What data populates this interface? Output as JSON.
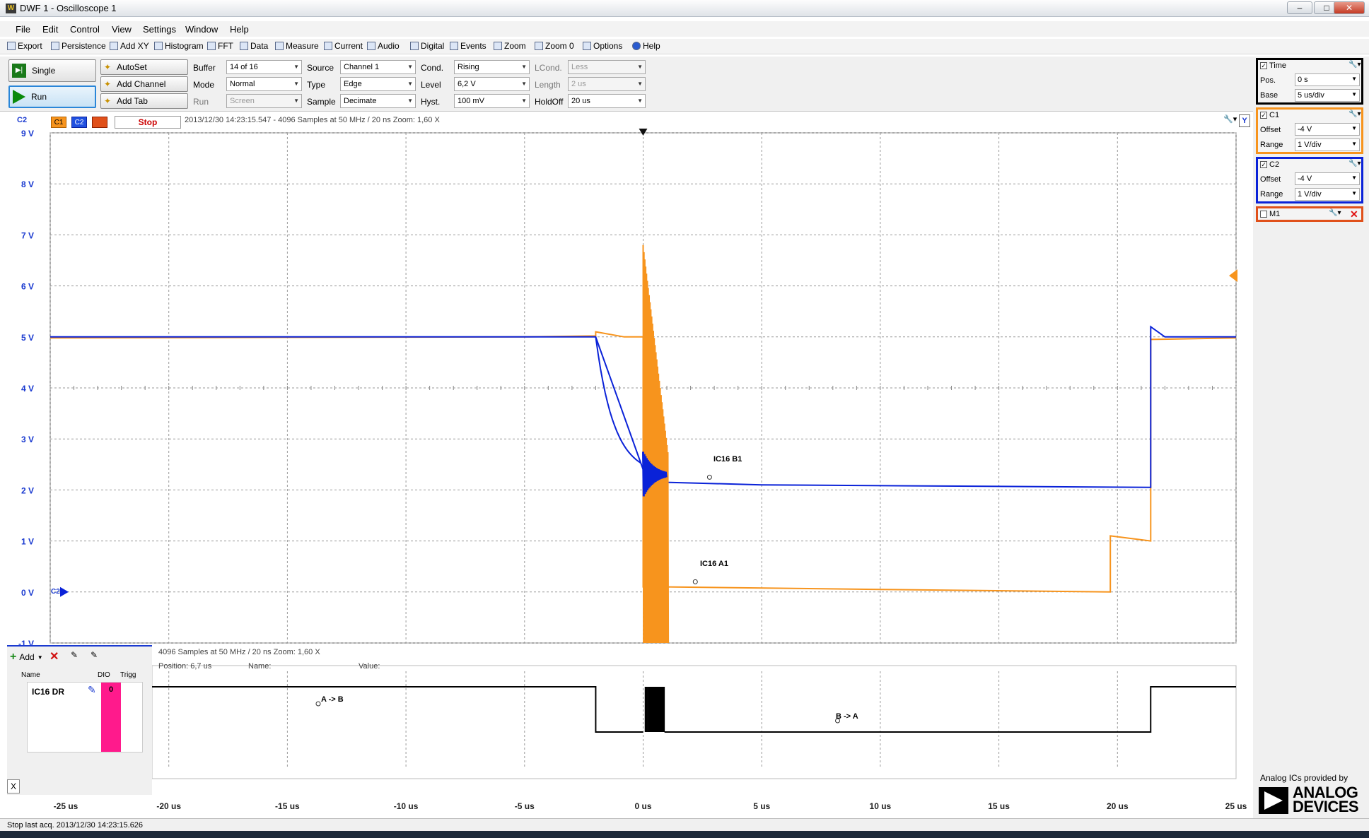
{
  "window": {
    "title": "DWF 1 - Oscilloscope 1",
    "app_icon": "waveforms-icon"
  },
  "menu": [
    "File",
    "Edit",
    "Control",
    "View",
    "Settings",
    "Window",
    "Help"
  ],
  "toolbar": [
    "Export",
    "Persistence",
    "Add XY",
    "Histogram",
    "FFT",
    "Data",
    "Measure",
    "Current",
    "Audio",
    "Digital",
    "Events",
    "Zoom",
    "Zoom 0",
    "Options",
    "Help"
  ],
  "controls": {
    "single": "Single",
    "run": "Run",
    "autoset": "AutoSet",
    "add_channel": "Add Channel",
    "add_tab": "Add Tab",
    "buffer_label": "Buffer",
    "buffer_value": "14 of 16",
    "mode_label": "Mode",
    "mode_value": "Normal",
    "run_label": "Run",
    "run_value": "Screen",
    "source_label": "Source",
    "source_value": "Channel 1",
    "type_label": "Type",
    "type_value": "Edge",
    "sample_label": "Sample",
    "sample_value": "Decimate",
    "cond_label": "Cond.",
    "cond_value": "Rising",
    "level_label": "Level",
    "level_value": "6,2 V",
    "hyst_label": "Hyst.",
    "hyst_value": "100 mV",
    "lcond_label": "LCond.",
    "lcond_value": "Less",
    "length_label": "Length",
    "length_value": "2 us",
    "holdoff_label": "HoldOff",
    "holdoff_value": "20 us"
  },
  "scope": {
    "axis_channel": "C2",
    "chan_tags": [
      "C1",
      "C2",
      "M1"
    ],
    "state": "Stop",
    "info": "2013/12/30  14:23:15.547 - 4096 Samples at 50 MHz / 20 ns Zoom: 1,60 X",
    "y_ticks": [
      "9 V",
      "8 V",
      "7 V",
      "6 V",
      "5 V",
      "4 V",
      "3 V",
      "2 V",
      "1 V",
      "0 V",
      "-1 V"
    ],
    "x_ticks": [
      "-25 us",
      "-20 us",
      "-15 us",
      "-10 us",
      "-5 us",
      "0 us",
      "5 us",
      "10 us",
      "15 us",
      "20 us",
      "25 us"
    ],
    "labels": {
      "b1": "IC16 B1",
      "a1": "IC16 A1",
      "c2_marker": "C2",
      "x_button": "X",
      "y_button": "Y"
    },
    "colors": {
      "c1": "#f7941d",
      "c2": "#0a22d8",
      "m1": "#e0501a",
      "grid": "#9a9a9a"
    }
  },
  "chart_data": [
    {
      "type": "line",
      "series": [
        {
          "name": "C1",
          "points": [
            [
              -25,
              4.98
            ],
            [
              -5,
              5.0
            ],
            [
              -2,
              5.02
            ],
            [
              -2,
              5.1
            ],
            [
              -0.8,
              5.0
            ],
            [
              0,
              5.0
            ],
            [
              0,
              0.1
            ],
            [
              1,
              0.1
            ],
            [
              10,
              0.05
            ],
            [
              19.7,
              0.0
            ],
            [
              19.7,
              1.1
            ],
            [
              21.4,
              1.0
            ],
            [
              21.4,
              4.95
            ],
            [
              25,
              4.98
            ]
          ]
        },
        {
          "name": "C2",
          "points": [
            [
              -25,
              5.0
            ],
            [
              -2,
              5.0
            ],
            [
              -1,
              3.7
            ],
            [
              0,
              2.4
            ],
            [
              1,
              2.15
            ],
            [
              5,
              2.1
            ],
            [
              21.4,
              2.05
            ],
            [
              21.4,
              5.2
            ],
            [
              22,
              5.0
            ],
            [
              25,
              5.0
            ]
          ]
        }
      ],
      "ylim": [
        -1,
        9
      ],
      "xlim": [
        -25,
        25
      ]
    }
  ],
  "logic": {
    "add": "Add",
    "col_name": "Name",
    "col_dio": "DIO",
    "col_trigg": "Trigg",
    "signal_name": "IC16 DR",
    "signal_dio": "0",
    "info": "4096 Samples at 50 MHz / 20 ns Zoom: 1,60 X",
    "position_label": "Position: 6,7 us",
    "name_label": "Name:",
    "value_label": "Value:",
    "ann_ab": "A -> B",
    "ann_ba": "B -> A",
    "dio_color": "#ff1a8c"
  },
  "right": {
    "time_title": "Time",
    "pos_label": "Pos.",
    "pos_value": "0 s",
    "base_label": "Base",
    "base_value": "5 us/div",
    "c1_title": "C1",
    "c1_offset_label": "Offset",
    "c1_offset": "-4 V",
    "c1_range_label": "Range",
    "c1_range": "1 V/div",
    "c2_title": "C2",
    "c2_offset_label": "Offset",
    "c2_offset": "-4 V",
    "c2_range_label": "Range",
    "c2_range": "1 V/div",
    "m1_title": "M1",
    "logo_tag": "Analog ICs provided by",
    "logo_line1": "ANALOG",
    "logo_line2": "DEVICES"
  },
  "status": "Stop last acq. 2013/12/30  14:23:15.626"
}
